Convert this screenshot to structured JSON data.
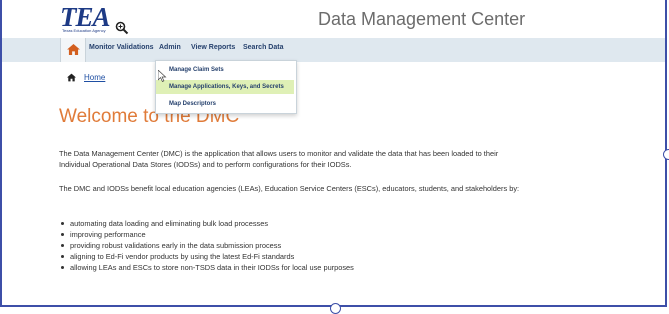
{
  "header": {
    "logo_text": "TEA",
    "logo_subtitle": "Texas Education Agency",
    "app_title": "Data Management Center"
  },
  "nav": {
    "items": [
      {
        "label": "Monitor Validations"
      },
      {
        "label": "Admin"
      },
      {
        "label": "View Reports"
      },
      {
        "label": "Search Data"
      }
    ]
  },
  "admin_menu": {
    "items": [
      {
        "label": "Manage Claim Sets"
      },
      {
        "label": "Manage Applications, Keys, and Secrets"
      },
      {
        "label": "Map Descriptors"
      }
    ],
    "hovered_index": 1
  },
  "breadcrumb": {
    "home_label": "Home"
  },
  "main": {
    "welcome": "Welcome to the DMC",
    "intro": "The Data Management Center (DMC) is the application that allows users to monitor and validate the data that has been loaded to their Individual Operational Data Stores (IODSs) and to perform configurations for their IODSs.",
    "benefit": "The DMC and IODSs benefit local education agencies (LEAs), Education Service Centers (ESCs), educators, students, and stakeholders by:",
    "bullets": [
      "automating data loading and eliminating bulk load processes",
      "improving performance",
      "providing robust validations early in the data submission process",
      "aligning to Ed-Fi vendor products by using the latest Ed-Fi standards",
      "allowing LEAs and ESCs to store non-TSDS data in their IODSs for local use purposes"
    ]
  },
  "colors": {
    "brand_blue": "#1d3a85",
    "nav_bg": "#dfe8ef",
    "welcome_orange": "#e07b39",
    "menu_hover": "#dff0b6",
    "frame_border": "#3d4fa8"
  },
  "icons": {
    "home": "home-icon",
    "zoom": "zoom-in-icon",
    "cursor": "mouse-pointer-icon"
  }
}
